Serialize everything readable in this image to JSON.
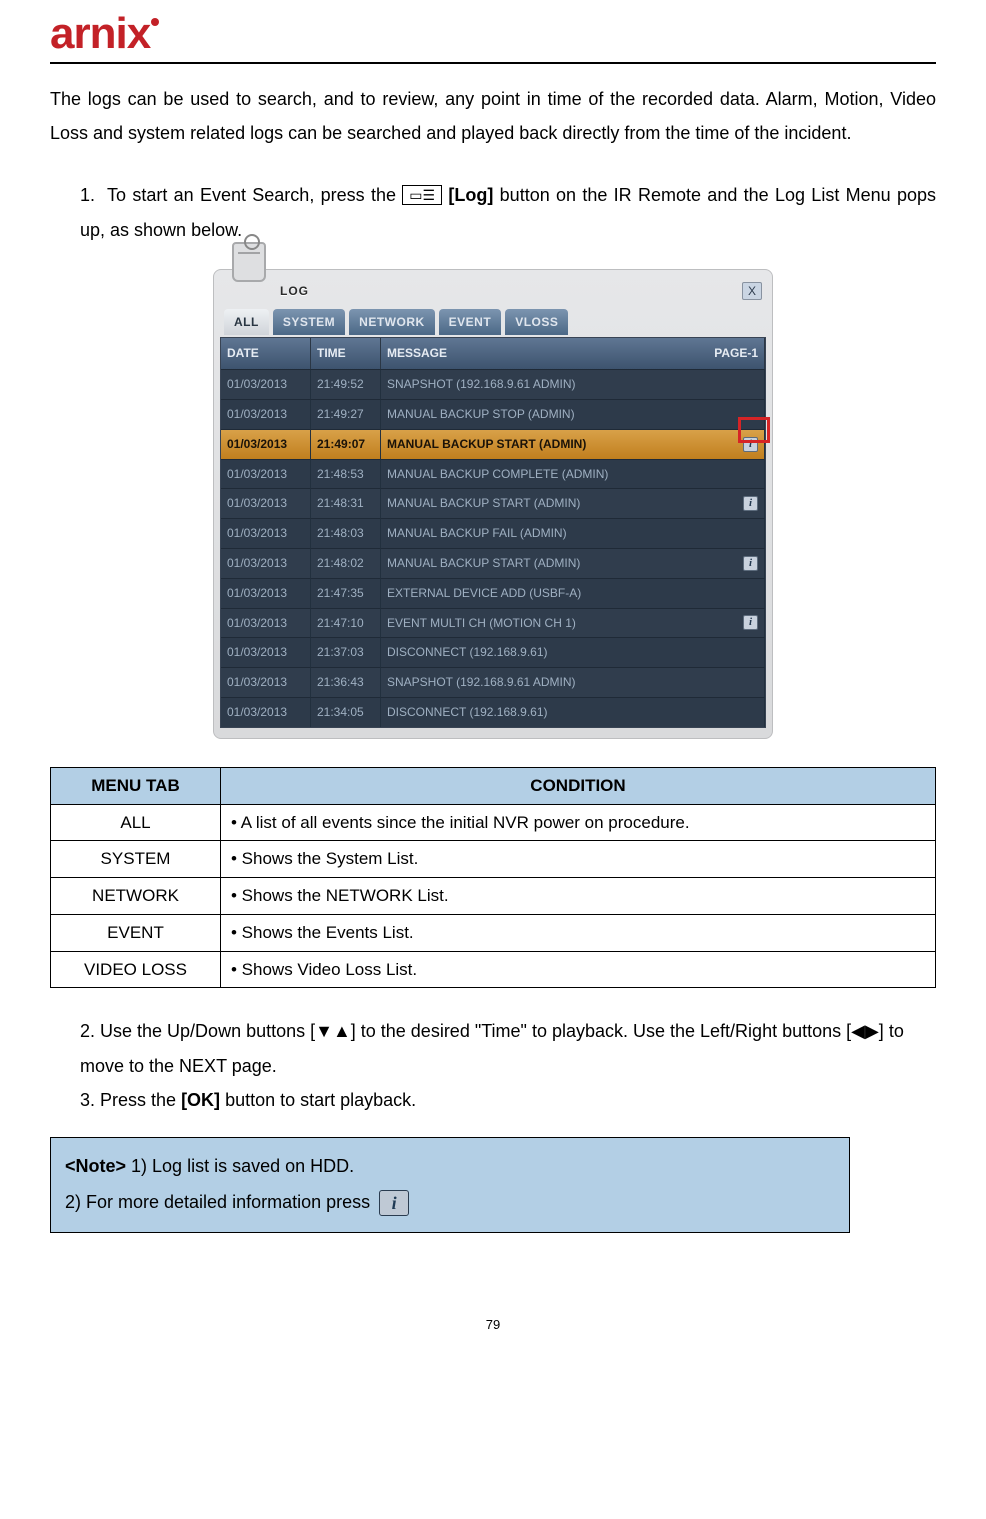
{
  "brand": "arnix",
  "intro": "The logs can be used to search, and to review, any point in time of the recorded data. Alarm, Motion, Video Loss and system related logs can be searched and played back directly from the time of the incident.",
  "step1_a": "To start an Event Search, press the ",
  "step1_icon": "[Log]",
  "step1_b": " button on the IR Remote and the Log List Menu pops up, as shown below.",
  "step1_num": "1.",
  "log_window": {
    "title": "LOG",
    "close": "X",
    "tabs": [
      "ALL",
      "SYSTEM",
      "NETWORK",
      "EVENT",
      "VLOSS"
    ],
    "header": {
      "date": "DATE",
      "time": "TIME",
      "message": "MESSAGE",
      "page": "PAGE-1"
    },
    "rows": [
      {
        "date": "01/03/2013",
        "time": "21:49:52",
        "msg": "SNAPSHOT (192.168.9.61 ADMIN)",
        "info": false,
        "selected": false
      },
      {
        "date": "01/03/2013",
        "time": "21:49:27",
        "msg": "MANUAL BACKUP STOP (ADMIN)",
        "info": false,
        "selected": false
      },
      {
        "date": "01/03/2013",
        "time": "21:49:07",
        "msg": "MANUAL BACKUP START (ADMIN)",
        "info": true,
        "selected": true
      },
      {
        "date": "01/03/2013",
        "time": "21:48:53",
        "msg": "MANUAL BACKUP COMPLETE (ADMIN)",
        "info": false,
        "selected": false
      },
      {
        "date": "01/03/2013",
        "time": "21:48:31",
        "msg": "MANUAL BACKUP START (ADMIN)",
        "info": true,
        "selected": false
      },
      {
        "date": "01/03/2013",
        "time": "21:48:03",
        "msg": "MANUAL BACKUP FAIL (ADMIN)",
        "info": false,
        "selected": false
      },
      {
        "date": "01/03/2013",
        "time": "21:48:02",
        "msg": "MANUAL BACKUP START (ADMIN)",
        "info": true,
        "selected": false
      },
      {
        "date": "01/03/2013",
        "time": "21:47:35",
        "msg": "EXTERNAL DEVICE ADD (USBF-A)",
        "info": false,
        "selected": false
      },
      {
        "date": "01/03/2013",
        "time": "21:47:10",
        "msg": "EVENT MULTI CH (MOTION CH 1)",
        "info": true,
        "selected": false
      },
      {
        "date": "01/03/2013",
        "time": "21:37:03",
        "msg": "DISCONNECT (192.168.9.61)",
        "info": false,
        "selected": false
      },
      {
        "date": "01/03/2013",
        "time": "21:36:43",
        "msg": "SNAPSHOT (192.168.9.61 ADMIN)",
        "info": false,
        "selected": false
      },
      {
        "date": "01/03/2013",
        "time": "21:34:05",
        "msg": "DISCONNECT (192.168.9.61)",
        "info": false,
        "selected": false
      }
    ]
  },
  "menu_table": {
    "head": {
      "tab": "MENU TAB",
      "cond": "CONDITION"
    },
    "rows": [
      {
        "tab": "ALL",
        "cond": "• A list of all events since the initial NVR power on procedure."
      },
      {
        "tab": "SYSTEM",
        "cond": "• Shows the System List."
      },
      {
        "tab": "NETWORK",
        "cond": "• Shows the NETWORK List."
      },
      {
        "tab": "EVENT",
        "cond": "• Shows the Events List."
      },
      {
        "tab": "VIDEO LOSS",
        "cond": "• Shows Video Loss List."
      }
    ]
  },
  "step2": "2. Use the Up/Down buttons [▼▲] to the desired \"Time\" to playback. Use the Left/Right buttons [◀▶] to move to the NEXT page.",
  "step3_a": "3. Press the ",
  "step3_b": "[OK]",
  "step3_c": " button to start playback.",
  "note": {
    "label": "<Note>",
    "line1": " 1) Log list is saved on HDD.",
    "line2": "2) For more detailed information press "
  },
  "page_number": "79"
}
